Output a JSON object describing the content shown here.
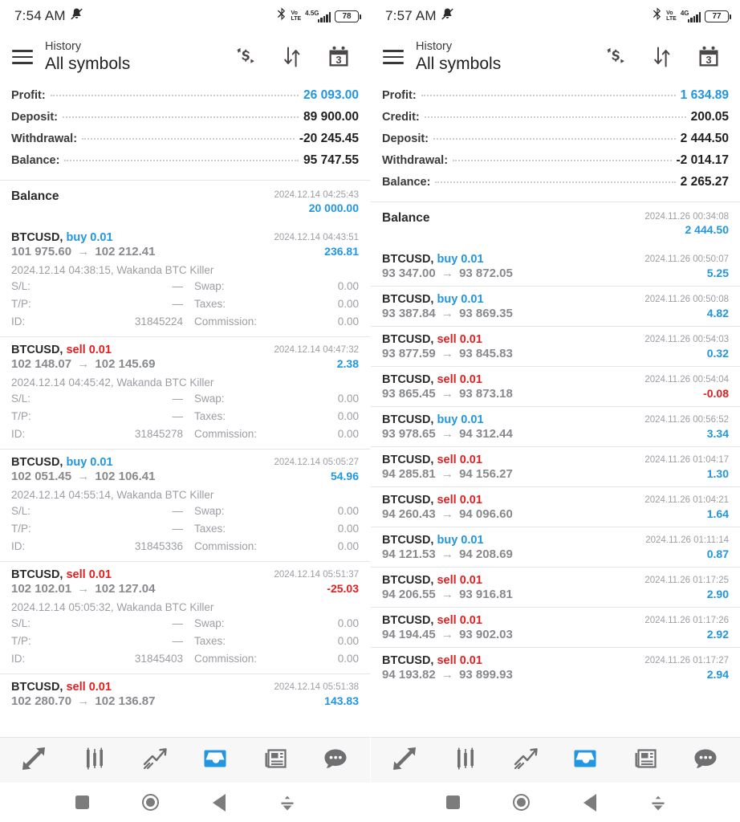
{
  "accent_blue": "#2196E3",
  "accent_red": "#E02020",
  "screens": [
    {
      "status": {
        "clock": "7:54 AM",
        "mute_icon": "vibrate-mute-icon",
        "bluetooth_icon": "bluetooth-icon",
        "volte": "Vo LTE",
        "volte_line1": "Vo",
        "volte_line2": "LTE",
        "network": "4.5G",
        "signal_icon": "signal-bars-icon",
        "battery": "78"
      },
      "header": {
        "menu_icon": "hamburger-menu-icon",
        "subtitle": "History",
        "title": "All symbols",
        "action_currency": "currency-exchange-icon",
        "action_sort": "sort-arrows-icon",
        "action_calendar": "calendar-icon",
        "calendar_day": "3"
      },
      "summary": [
        {
          "label": "Profit:",
          "value": "26 093.00",
          "color": "blue"
        },
        {
          "label": "Deposit:",
          "value": "89 900.00",
          "color": "black"
        },
        {
          "label": "Withdrawal:",
          "value": "-20 245.45",
          "color": "black"
        },
        {
          "label": "Balance:",
          "value": "95 747.55",
          "color": "black"
        }
      ],
      "balance_record": {
        "label": "Balance",
        "time": "2024.12.14 04:25:43",
        "amount": "20 000.00"
      },
      "deals": [
        {
          "symbol": "BTCUSD,",
          "side": "buy",
          "volume": "0.01",
          "time": "2024.12.14 04:43:51",
          "price_open": "101 975.60",
          "price_close": "102 212.41",
          "profit": "236.81",
          "profit_sign": "pos",
          "meta": "2024.12.14 04:38:15, Wakanda BTC Killer",
          "sl_label": "S/L:",
          "sl_value": "—",
          "tp_label": "T/P:",
          "tp_value": "—",
          "id_label": "ID:",
          "id_value": "31845224",
          "swap_label": "Swap:",
          "swap_value": "0.00",
          "taxes_label": "Taxes:",
          "taxes_value": "0.00",
          "commission_label": "Commission:",
          "commission_value": "0.00",
          "expanded": true
        },
        {
          "symbol": "BTCUSD,",
          "side": "sell",
          "volume": "0.01",
          "time": "2024.12.14 04:47:32",
          "price_open": "102 148.07",
          "price_close": "102 145.69",
          "profit": "2.38",
          "profit_sign": "pos",
          "meta": "2024.12.14 04:45:42, Wakanda BTC Killer",
          "sl_label": "S/L:",
          "sl_value": "—",
          "tp_label": "T/P:",
          "tp_value": "—",
          "id_label": "ID:",
          "id_value": "31845278",
          "swap_label": "Swap:",
          "swap_value": "0.00",
          "taxes_label": "Taxes:",
          "taxes_value": "0.00",
          "commission_label": "Commission:",
          "commission_value": "0.00",
          "expanded": true
        },
        {
          "symbol": "BTCUSD,",
          "side": "buy",
          "volume": "0.01",
          "time": "2024.12.14 05:05:27",
          "price_open": "102 051.45",
          "price_close": "102 106.41",
          "profit": "54.96",
          "profit_sign": "pos",
          "meta": "2024.12.14 04:55:14, Wakanda BTC Killer",
          "sl_label": "S/L:",
          "sl_value": "—",
          "tp_label": "T/P:",
          "tp_value": "—",
          "id_label": "ID:",
          "id_value": "31845336",
          "swap_label": "Swap:",
          "swap_value": "0.00",
          "taxes_label": "Taxes:",
          "taxes_value": "0.00",
          "commission_label": "Commission:",
          "commission_value": "0.00",
          "expanded": true
        },
        {
          "symbol": "BTCUSD,",
          "side": "sell",
          "volume": "0.01",
          "time": "2024.12.14 05:51:37",
          "price_open": "102 102.01",
          "price_close": "102 127.04",
          "profit": "-25.03",
          "profit_sign": "neg",
          "meta": "2024.12.14 05:05:32, Wakanda BTC Killer",
          "sl_label": "S/L:",
          "sl_value": "—",
          "tp_label": "T/P:",
          "tp_value": "—",
          "id_label": "ID:",
          "id_value": "31845403",
          "swap_label": "Swap:",
          "swap_value": "0.00",
          "taxes_label": "Taxes:",
          "taxes_value": "0.00",
          "commission_label": "Commission:",
          "commission_value": "0.00",
          "expanded": true
        },
        {
          "symbol": "BTCUSD,",
          "side": "sell",
          "volume": "0.01",
          "time": "2024.12.14 05:51:38",
          "price_open": "102 280.70",
          "price_close": "102 136.87",
          "profit": "143.83",
          "profit_sign": "pos",
          "expanded": false
        }
      ]
    },
    {
      "status": {
        "clock": "7:57 AM",
        "mute_icon": "vibrate-mute-icon",
        "bluetooth_icon": "bluetooth-icon",
        "volte": "Vo LTE",
        "volte_line1": "Vo",
        "volte_line2": "LTE",
        "network": "4G",
        "signal_icon": "signal-bars-icon",
        "battery": "77"
      },
      "header": {
        "menu_icon": "hamburger-menu-icon",
        "subtitle": "History",
        "title": "All symbols",
        "action_currency": "currency-exchange-icon",
        "action_sort": "sort-arrows-icon",
        "action_calendar": "calendar-icon",
        "calendar_day": "3"
      },
      "summary": [
        {
          "label": "Profit:",
          "value": "1 634.89",
          "color": "blue"
        },
        {
          "label": "Credit:",
          "value": "200.05",
          "color": "black"
        },
        {
          "label": "Deposit:",
          "value": "2 444.50",
          "color": "black"
        },
        {
          "label": "Withdrawal:",
          "value": "-2 014.17",
          "color": "black"
        },
        {
          "label": "Balance:",
          "value": "2 265.27",
          "color": "black"
        }
      ],
      "balance_record": {
        "label": "Balance",
        "time": "2024.11.26 00:34:08",
        "amount": "2 444.50"
      },
      "deals": [
        {
          "symbol": "BTCUSD,",
          "side": "buy",
          "volume": "0.01",
          "time": "2024.11.26 00:50:07",
          "price_open": "93 347.00",
          "price_close": "93 872.05",
          "profit": "5.25",
          "profit_sign": "pos",
          "expanded": false
        },
        {
          "symbol": "BTCUSD,",
          "side": "buy",
          "volume": "0.01",
          "time": "2024.11.26 00:50:08",
          "price_open": "93 387.84",
          "price_close": "93 869.35",
          "profit": "4.82",
          "profit_sign": "pos",
          "expanded": false
        },
        {
          "symbol": "BTCUSD,",
          "side": "sell",
          "volume": "0.01",
          "time": "2024.11.26 00:54:03",
          "price_open": "93 877.59",
          "price_close": "93 845.83",
          "profit": "0.32",
          "profit_sign": "pos",
          "expanded": false
        },
        {
          "symbol": "BTCUSD,",
          "side": "sell",
          "volume": "0.01",
          "time": "2024.11.26 00:54:04",
          "price_open": "93 865.45",
          "price_close": "93 873.18",
          "profit": "-0.08",
          "profit_sign": "neg",
          "expanded": false
        },
        {
          "symbol": "BTCUSD,",
          "side": "buy",
          "volume": "0.01",
          "time": "2024.11.26 00:56:52",
          "price_open": "93 978.65",
          "price_close": "94 312.44",
          "profit": "3.34",
          "profit_sign": "pos",
          "expanded": false
        },
        {
          "symbol": "BTCUSD,",
          "side": "sell",
          "volume": "0.01",
          "time": "2024.11.26 01:04:17",
          "price_open": "94 285.81",
          "price_close": "94 156.27",
          "profit": "1.30",
          "profit_sign": "pos",
          "expanded": false
        },
        {
          "symbol": "BTCUSD,",
          "side": "sell",
          "volume": "0.01",
          "time": "2024.11.26 01:04:21",
          "price_open": "94 260.43",
          "price_close": "94 096.60",
          "profit": "1.64",
          "profit_sign": "pos",
          "expanded": false
        },
        {
          "symbol": "BTCUSD,",
          "side": "buy",
          "volume": "0.01",
          "time": "2024.11.26 01:11:14",
          "price_open": "94 121.53",
          "price_close": "94 208.69",
          "profit": "0.87",
          "profit_sign": "pos",
          "expanded": false
        },
        {
          "symbol": "BTCUSD,",
          "side": "sell",
          "volume": "0.01",
          "time": "2024.11.26 01:17:25",
          "price_open": "94 206.55",
          "price_close": "93 916.81",
          "profit": "2.90",
          "profit_sign": "pos",
          "expanded": false
        },
        {
          "symbol": "BTCUSD,",
          "side": "sell",
          "volume": "0.01",
          "time": "2024.11.26 01:17:26",
          "price_open": "94 194.45",
          "price_close": "93 902.03",
          "profit": "2.92",
          "profit_sign": "pos",
          "expanded": false
        },
        {
          "symbol": "BTCUSD,",
          "side": "sell",
          "volume": "0.01",
          "time": "2024.11.26 01:17:27",
          "price_open": "94 193.82",
          "price_close": "93 899.93",
          "profit": "2.94",
          "profit_sign": "pos",
          "expanded": false
        }
      ]
    }
  ],
  "tabbar": {
    "items": [
      {
        "icon": "quotes-arrows-icon",
        "active": false
      },
      {
        "icon": "candlestick-charts-icon",
        "active": false
      },
      {
        "icon": "trade-trend-icon",
        "active": false
      },
      {
        "icon": "history-inbox-icon",
        "active": true
      },
      {
        "icon": "news-paper-icon",
        "active": false
      },
      {
        "icon": "chat-bubble-icon",
        "active": false
      }
    ]
  },
  "navbar": {
    "items": [
      {
        "icon": "recents-square-icon"
      },
      {
        "icon": "home-circle-icon"
      },
      {
        "icon": "back-triangle-icon"
      },
      {
        "icon": "hide-keyboard-icon"
      }
    ]
  }
}
